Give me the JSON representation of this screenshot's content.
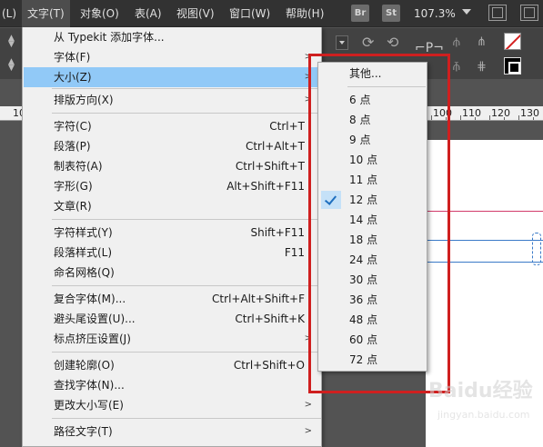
{
  "menubar": {
    "items": [
      {
        "label": "(L)",
        "active": false
      },
      {
        "label": "文字(T)",
        "active": true
      },
      {
        "label": "对象(O)",
        "active": false
      },
      {
        "label": "表(A)",
        "active": false
      },
      {
        "label": "视图(V)",
        "active": false
      },
      {
        "label": "窗口(W)",
        "active": false
      },
      {
        "label": "帮助(H)",
        "active": false
      }
    ],
    "bridge_badge": "Br",
    "stock_badge": "St",
    "zoom": "107.3%"
  },
  "ruler": {
    "numbers": [
      "10",
      "100",
      "110",
      "120",
      "130"
    ]
  },
  "text_menu": {
    "items": [
      {
        "label": "从 Typekit 添加字体...",
        "shortcut": "",
        "submenu": false
      },
      {
        "label": "字体(F)",
        "shortcut": "",
        "submenu": true
      },
      {
        "label": "大小(Z)",
        "shortcut": "",
        "submenu": true,
        "highlighted": true
      },
      {
        "label": "排版方向(X)",
        "shortcut": "",
        "submenu": true
      },
      {
        "label": "字符(C)",
        "shortcut": "Ctrl+T",
        "submenu": false
      },
      {
        "label": "段落(P)",
        "shortcut": "Ctrl+Alt+T",
        "submenu": false
      },
      {
        "label": "制表符(A)",
        "shortcut": "Ctrl+Shift+T",
        "submenu": false
      },
      {
        "label": "字形(G)",
        "shortcut": "Alt+Shift+F11",
        "submenu": false
      },
      {
        "label": "文章(R)",
        "shortcut": "",
        "submenu": false
      },
      {
        "label": "字符样式(Y)",
        "shortcut": "Shift+F11",
        "submenu": false
      },
      {
        "label": "段落样式(L)",
        "shortcut": "F11",
        "submenu": false
      },
      {
        "label": "命名网格(Q)",
        "shortcut": "",
        "submenu": false
      },
      {
        "label": "复合字体(M)...",
        "shortcut": "Ctrl+Alt+Shift+F",
        "submenu": false
      },
      {
        "label": "避头尾设置(U)...",
        "shortcut": "Ctrl+Shift+K",
        "submenu": false
      },
      {
        "label": "标点挤压设置(J)",
        "shortcut": "",
        "submenu": true
      },
      {
        "label": "创建轮廓(O)",
        "shortcut": "Ctrl+Shift+O",
        "submenu": false
      },
      {
        "label": "查找字体(N)...",
        "shortcut": "",
        "submenu": false
      },
      {
        "label": "更改大小写(E)",
        "shortcut": "",
        "submenu": true
      },
      {
        "label": "路径文字(T)",
        "shortcut": "",
        "submenu": true
      }
    ]
  },
  "size_submenu": {
    "items": [
      {
        "label": "其他...",
        "checked": false
      },
      {
        "label": "6 点",
        "checked": false
      },
      {
        "label": "8 点",
        "checked": false
      },
      {
        "label": "9 点",
        "checked": false
      },
      {
        "label": "10 点",
        "checked": false
      },
      {
        "label": "11 点",
        "checked": false
      },
      {
        "label": "12 点",
        "checked": true
      },
      {
        "label": "14 点",
        "checked": false
      },
      {
        "label": "18 点",
        "checked": false
      },
      {
        "label": "24 点",
        "checked": false
      },
      {
        "label": "30 点",
        "checked": false
      },
      {
        "label": "36 点",
        "checked": false
      },
      {
        "label": "48 点",
        "checked": false
      },
      {
        "label": "60 点",
        "checked": false
      },
      {
        "label": "72 点",
        "checked": false
      }
    ]
  },
  "watermark": {
    "brand": "Baidu经验",
    "url": "jingyan.baidu.com"
  },
  "colors": {
    "menubar_bg": "#323232",
    "menu_bg": "#f0f0f0",
    "highlight": "#91c9f7",
    "annotation": "#cf1f1f"
  }
}
